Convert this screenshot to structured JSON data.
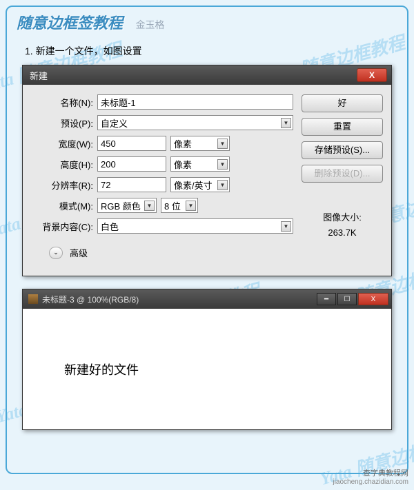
{
  "page": {
    "title_main": "随意边框签教程",
    "title_sub": "金玉格",
    "step1": "1. 新建一个文件，如图设置"
  },
  "dialog": {
    "title": "新建",
    "close_icon": "X",
    "rows": {
      "name_label": "名称(N):",
      "name_value": "未标题-1",
      "preset_label": "预设(P):",
      "preset_value": "自定义",
      "width_label": "宽度(W):",
      "width_value": "450",
      "width_unit": "像素",
      "height_label": "高度(H):",
      "height_value": "200",
      "height_unit": "像素",
      "res_label": "分辨率(R):",
      "res_value": "72",
      "res_unit": "像素/英寸",
      "mode_label": "模式(M):",
      "mode_value": "RGB 颜色",
      "bit_value": "8 位",
      "bg_label": "背景内容(C):",
      "bg_value": "白色"
    },
    "buttons": {
      "ok": "好",
      "reset": "重置",
      "save_preset": "存储预设(S)...",
      "delete_preset": "删除预设(D)..."
    },
    "image_size_label": "图像大小:",
    "image_size_value": "263.7K",
    "advanced": "高级"
  },
  "canvas": {
    "title": "未标题-3 @ 100%(RGB/8)",
    "body_text": "新建好的文件"
  },
  "watermark_text": "Yata 随意边框教程",
  "footer": {
    "top": "查字典教程网",
    "bottom": "jiaocheng.chazidian.com"
  },
  "caret": "▼",
  "chev": "⌄"
}
